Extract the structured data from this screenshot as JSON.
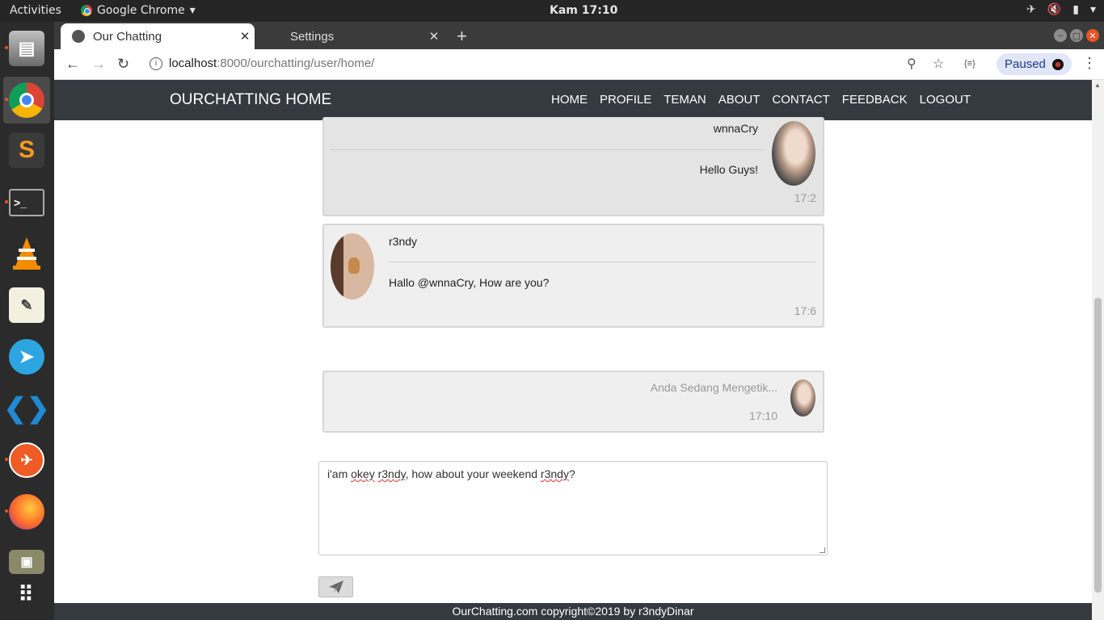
{
  "os": {
    "activities": "Activities",
    "app_name": "Google Chrome",
    "clock": "Kam 17:10"
  },
  "browser": {
    "tabs": [
      {
        "label": "Our Chatting"
      },
      {
        "label": "Settings"
      }
    ],
    "url_host": "localhost",
    "url_rest": ":8000/ourchatting/user/home/",
    "profile_label": "Paused"
  },
  "site": {
    "brand": "OURCHATTING HOME",
    "nav": [
      "HOME",
      "PROFILE",
      "TEMAN",
      "ABOUT",
      "CONTACT",
      "FEEDBACK",
      "LOGOUT"
    ]
  },
  "messages": [
    {
      "name": "wnnaCry",
      "text": "Hello Guys!",
      "time": "17:2"
    },
    {
      "name": "r3ndy",
      "text": "Hallo @wnnaCry, How are you?",
      "time": "17:6"
    }
  ],
  "typing": {
    "text": "Anda Sedang Mengetik...",
    "time": "17:10"
  },
  "composer": {
    "parts": [
      "i'am ",
      "okey",
      " ",
      "r3ndy",
      ", how about your weekend ",
      "r3ndy",
      "?"
    ]
  },
  "footer": "OurChatting.com copyright©2019 by r3ndyDinar"
}
